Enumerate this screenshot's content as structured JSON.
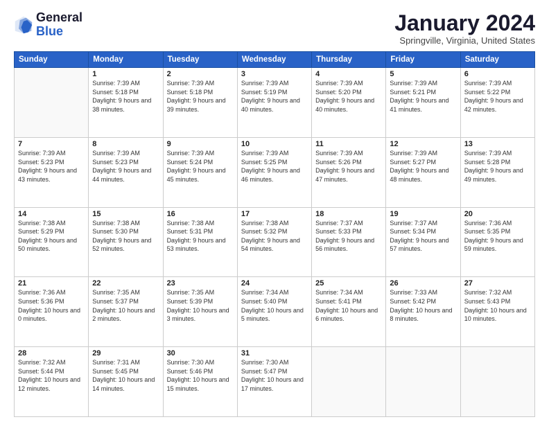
{
  "logo": {
    "line1": "General",
    "line2": "Blue"
  },
  "header": {
    "title": "January 2024",
    "subtitle": "Springville, Virginia, United States"
  },
  "weekdays": [
    "Sunday",
    "Monday",
    "Tuesday",
    "Wednesday",
    "Thursday",
    "Friday",
    "Saturday"
  ],
  "weeks": [
    [
      {
        "day": "",
        "sunrise": "",
        "sunset": "",
        "daylight": "",
        "empty": true
      },
      {
        "day": "1",
        "sunrise": "Sunrise: 7:39 AM",
        "sunset": "Sunset: 5:18 PM",
        "daylight": "Daylight: 9 hours and 38 minutes."
      },
      {
        "day": "2",
        "sunrise": "Sunrise: 7:39 AM",
        "sunset": "Sunset: 5:18 PM",
        "daylight": "Daylight: 9 hours and 39 minutes."
      },
      {
        "day": "3",
        "sunrise": "Sunrise: 7:39 AM",
        "sunset": "Sunset: 5:19 PM",
        "daylight": "Daylight: 9 hours and 40 minutes."
      },
      {
        "day": "4",
        "sunrise": "Sunrise: 7:39 AM",
        "sunset": "Sunset: 5:20 PM",
        "daylight": "Daylight: 9 hours and 40 minutes."
      },
      {
        "day": "5",
        "sunrise": "Sunrise: 7:39 AM",
        "sunset": "Sunset: 5:21 PM",
        "daylight": "Daylight: 9 hours and 41 minutes."
      },
      {
        "day": "6",
        "sunrise": "Sunrise: 7:39 AM",
        "sunset": "Sunset: 5:22 PM",
        "daylight": "Daylight: 9 hours and 42 minutes."
      }
    ],
    [
      {
        "day": "7",
        "sunrise": "Sunrise: 7:39 AM",
        "sunset": "Sunset: 5:23 PM",
        "daylight": "Daylight: 9 hours and 43 minutes."
      },
      {
        "day": "8",
        "sunrise": "Sunrise: 7:39 AM",
        "sunset": "Sunset: 5:23 PM",
        "daylight": "Daylight: 9 hours and 44 minutes."
      },
      {
        "day": "9",
        "sunrise": "Sunrise: 7:39 AM",
        "sunset": "Sunset: 5:24 PM",
        "daylight": "Daylight: 9 hours and 45 minutes."
      },
      {
        "day": "10",
        "sunrise": "Sunrise: 7:39 AM",
        "sunset": "Sunset: 5:25 PM",
        "daylight": "Daylight: 9 hours and 46 minutes."
      },
      {
        "day": "11",
        "sunrise": "Sunrise: 7:39 AM",
        "sunset": "Sunset: 5:26 PM",
        "daylight": "Daylight: 9 hours and 47 minutes."
      },
      {
        "day": "12",
        "sunrise": "Sunrise: 7:39 AM",
        "sunset": "Sunset: 5:27 PM",
        "daylight": "Daylight: 9 hours and 48 minutes."
      },
      {
        "day": "13",
        "sunrise": "Sunrise: 7:39 AM",
        "sunset": "Sunset: 5:28 PM",
        "daylight": "Daylight: 9 hours and 49 minutes."
      }
    ],
    [
      {
        "day": "14",
        "sunrise": "Sunrise: 7:38 AM",
        "sunset": "Sunset: 5:29 PM",
        "daylight": "Daylight: 9 hours and 50 minutes."
      },
      {
        "day": "15",
        "sunrise": "Sunrise: 7:38 AM",
        "sunset": "Sunset: 5:30 PM",
        "daylight": "Daylight: 9 hours and 52 minutes."
      },
      {
        "day": "16",
        "sunrise": "Sunrise: 7:38 AM",
        "sunset": "Sunset: 5:31 PM",
        "daylight": "Daylight: 9 hours and 53 minutes."
      },
      {
        "day": "17",
        "sunrise": "Sunrise: 7:38 AM",
        "sunset": "Sunset: 5:32 PM",
        "daylight": "Daylight: 9 hours and 54 minutes."
      },
      {
        "day": "18",
        "sunrise": "Sunrise: 7:37 AM",
        "sunset": "Sunset: 5:33 PM",
        "daylight": "Daylight: 9 hours and 56 minutes."
      },
      {
        "day": "19",
        "sunrise": "Sunrise: 7:37 AM",
        "sunset": "Sunset: 5:34 PM",
        "daylight": "Daylight: 9 hours and 57 minutes."
      },
      {
        "day": "20",
        "sunrise": "Sunrise: 7:36 AM",
        "sunset": "Sunset: 5:35 PM",
        "daylight": "Daylight: 9 hours and 59 minutes."
      }
    ],
    [
      {
        "day": "21",
        "sunrise": "Sunrise: 7:36 AM",
        "sunset": "Sunset: 5:36 PM",
        "daylight": "Daylight: 10 hours and 0 minutes."
      },
      {
        "day": "22",
        "sunrise": "Sunrise: 7:35 AM",
        "sunset": "Sunset: 5:37 PM",
        "daylight": "Daylight: 10 hours and 2 minutes."
      },
      {
        "day": "23",
        "sunrise": "Sunrise: 7:35 AM",
        "sunset": "Sunset: 5:39 PM",
        "daylight": "Daylight: 10 hours and 3 minutes."
      },
      {
        "day": "24",
        "sunrise": "Sunrise: 7:34 AM",
        "sunset": "Sunset: 5:40 PM",
        "daylight": "Daylight: 10 hours and 5 minutes."
      },
      {
        "day": "25",
        "sunrise": "Sunrise: 7:34 AM",
        "sunset": "Sunset: 5:41 PM",
        "daylight": "Daylight: 10 hours and 6 minutes."
      },
      {
        "day": "26",
        "sunrise": "Sunrise: 7:33 AM",
        "sunset": "Sunset: 5:42 PM",
        "daylight": "Daylight: 10 hours and 8 minutes."
      },
      {
        "day": "27",
        "sunrise": "Sunrise: 7:32 AM",
        "sunset": "Sunset: 5:43 PM",
        "daylight": "Daylight: 10 hours and 10 minutes."
      }
    ],
    [
      {
        "day": "28",
        "sunrise": "Sunrise: 7:32 AM",
        "sunset": "Sunset: 5:44 PM",
        "daylight": "Daylight: 10 hours and 12 minutes."
      },
      {
        "day": "29",
        "sunrise": "Sunrise: 7:31 AM",
        "sunset": "Sunset: 5:45 PM",
        "daylight": "Daylight: 10 hours and 14 minutes."
      },
      {
        "day": "30",
        "sunrise": "Sunrise: 7:30 AM",
        "sunset": "Sunset: 5:46 PM",
        "daylight": "Daylight: 10 hours and 15 minutes."
      },
      {
        "day": "31",
        "sunrise": "Sunrise: 7:30 AM",
        "sunset": "Sunset: 5:47 PM",
        "daylight": "Daylight: 10 hours and 17 minutes."
      },
      {
        "day": "",
        "sunrise": "",
        "sunset": "",
        "daylight": "",
        "empty": true
      },
      {
        "day": "",
        "sunrise": "",
        "sunset": "",
        "daylight": "",
        "empty": true
      },
      {
        "day": "",
        "sunrise": "",
        "sunset": "",
        "daylight": "",
        "empty": true
      }
    ]
  ]
}
